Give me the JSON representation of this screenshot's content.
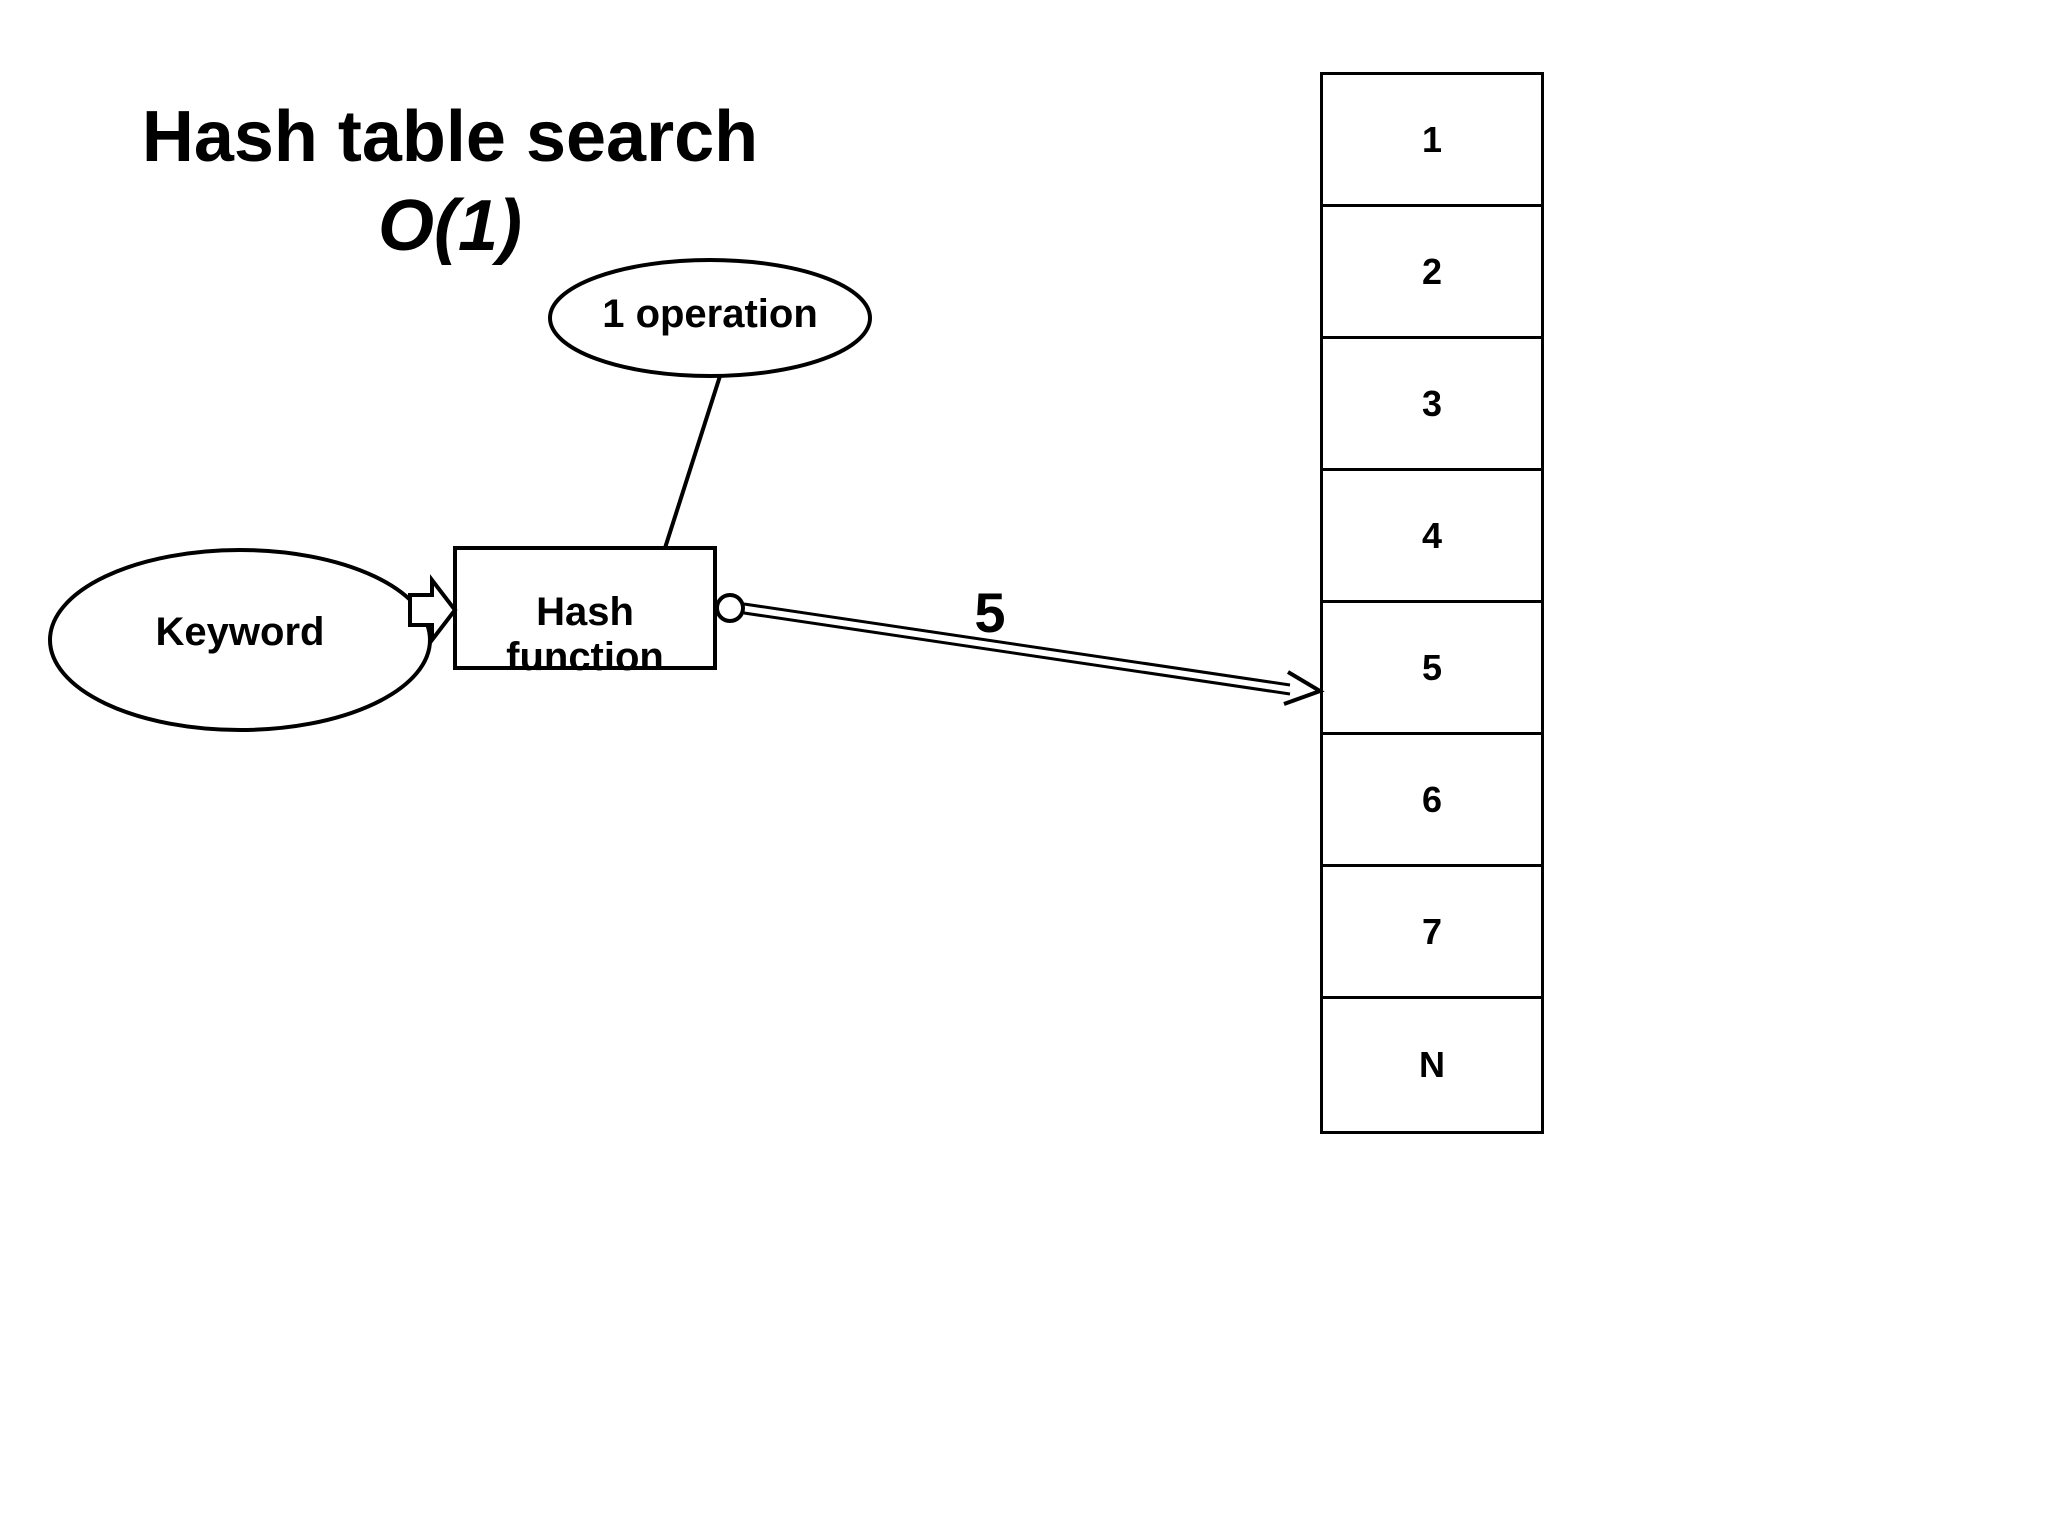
{
  "title": "Hash table search",
  "complexity": "O(1)",
  "keyword_label": "Keyword",
  "hash_function_label": "Hash function",
  "operation_label": "1 operation",
  "hash_output": "5",
  "table_cells": [
    "1",
    "2",
    "3",
    "4",
    "5",
    "6",
    "7",
    "N"
  ]
}
